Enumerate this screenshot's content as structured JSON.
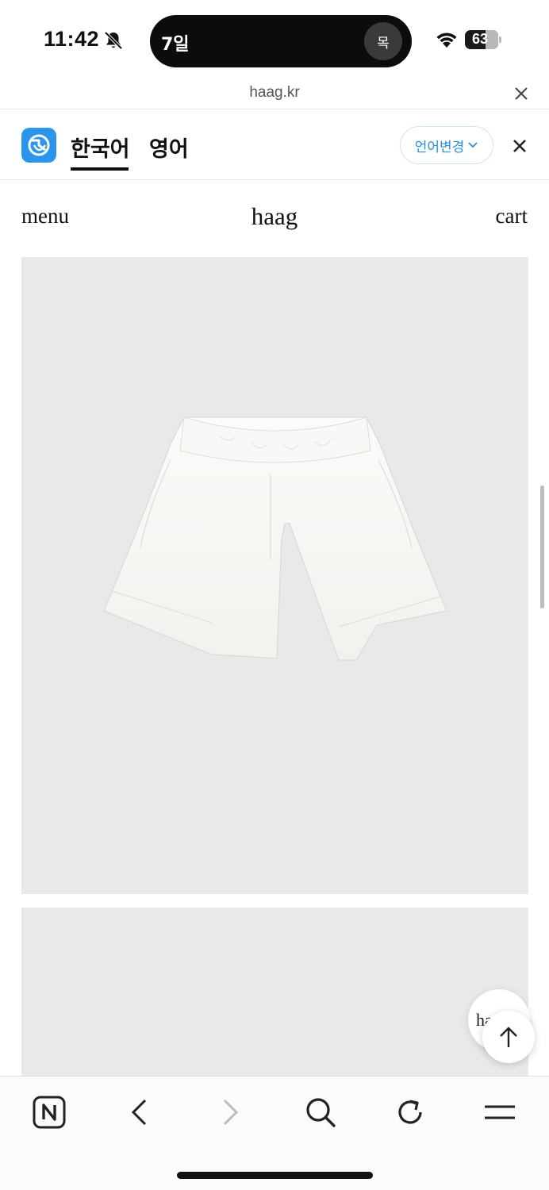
{
  "status_bar": {
    "time": "11:42",
    "island_text": "7일",
    "island_badge": "목",
    "battery_level": "63",
    "battery_fraction": 0.63
  },
  "url_bar": {
    "url": "haag.kr"
  },
  "translate_bar": {
    "tab_korean": "한국어",
    "tab_english": "영어",
    "language_change_label": "언어변경",
    "active_tab": "한국어",
    "accent_color": "#2a95ea"
  },
  "site_header": {
    "menu_label": "menu",
    "logo_text": "haag",
    "cart_label": "cart"
  },
  "product_images": [
    {
      "subject": "white shorts",
      "background": "#e9e9e9"
    },
    {
      "subject": "",
      "background": "#e9e9e9"
    }
  ],
  "floating": {
    "chat_text": "haag"
  },
  "toolbar": {
    "icons": [
      "naver-n-icon",
      "back-arrow-icon",
      "forward-arrow-icon",
      "search-icon",
      "reload-icon",
      "hamburger-menu-icon"
    ]
  }
}
